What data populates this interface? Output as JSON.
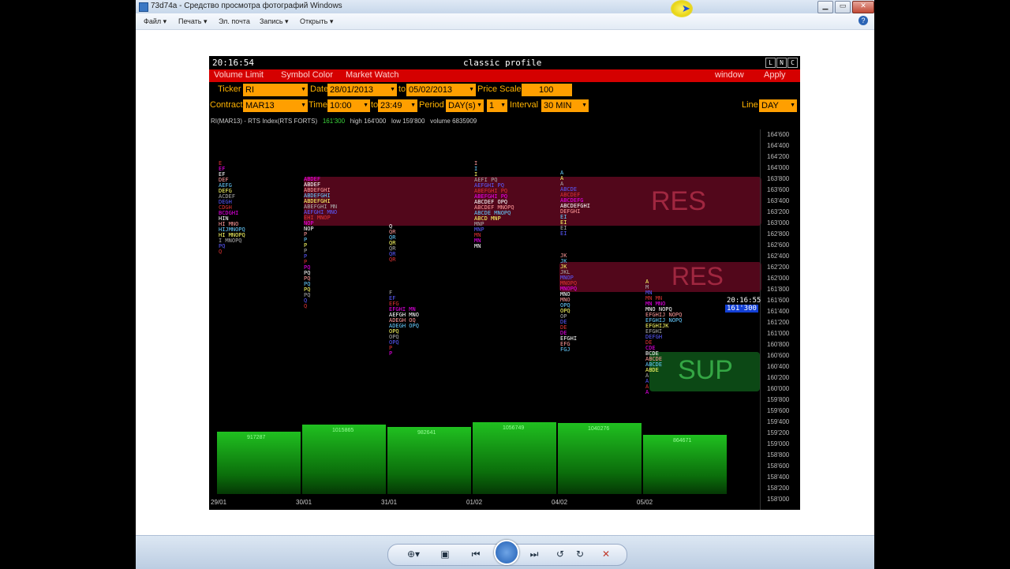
{
  "window": {
    "title": "73d74a - Средство просмотра фотографий Windows",
    "min": "▁",
    "max": "▭",
    "close": "✕"
  },
  "menu": {
    "items": [
      "Файл ▾",
      "Печать ▾",
      "Эл. почта",
      "Запись ▾",
      "Открыть ▾"
    ],
    "help": "?"
  },
  "platform": {
    "clock": "20:16:54",
    "title": "classic profile",
    "lnc": [
      "L",
      "N",
      "C"
    ],
    "tabs": [
      "Volume Limit",
      "Symbol Color",
      "Market Watch"
    ],
    "window_btn": "window",
    "apply_btn": "Apply",
    "ticker_label": "Ticker",
    "ticker": "RI",
    "date_label": "Date",
    "date_from": "28/01/2013",
    "to_label": "to",
    "date_to": "05/02/2013",
    "price_scale_label": "Price Scale",
    "price_scale": "100",
    "contract_label": "Contract",
    "contract": "MAR13",
    "time_label": "Time",
    "time_from": "10:00",
    "time_to": "23:49",
    "period_label": "Period",
    "period": "DAY(s)",
    "period_n": "1",
    "interval_label": "Interval",
    "interval": "30 MIN",
    "line_label": "Line",
    "line": "DAY",
    "info_symbol": "RI(MAR13) - RTS Index(RTS FORTS)",
    "info_last": "161'300",
    "info_high": "high 164'000",
    "info_low": "low 159'800",
    "info_volume": "volume 6835909",
    "cursor_time": "20:16:55",
    "cursor_price": "161'300",
    "zone_res1": "RES",
    "zone_res2": "RES",
    "zone_sup": "SUP"
  },
  "chart_data": {
    "type": "bar",
    "price_axis": [
      "164'600",
      "164'400",
      "164'200",
      "164'000",
      "163'800",
      "163'600",
      "163'400",
      "163'200",
      "163'000",
      "162'800",
      "162'600",
      "162'400",
      "162'200",
      "162'000",
      "161'800",
      "161'600",
      "161'400",
      "161'200",
      "161'000",
      "160'800",
      "160'600",
      "160'400",
      "160'200",
      "160'000",
      "159'800",
      "159'600",
      "159'400",
      "159'200",
      "159'000",
      "158'800",
      "158'600",
      "158'400",
      "158'200",
      "158'000"
    ],
    "categories": [
      "29/01",
      "30/01",
      "31/01",
      "01/02",
      "04/02",
      "05/02"
    ],
    "values": [
      917287,
      1015865,
      982641,
      1056749,
      1040276,
      864671
    ],
    "ylabel": "",
    "colors": {
      "res": "#8b0f2e",
      "sup": "#0e5e1a",
      "bars": "#18a818"
    }
  }
}
